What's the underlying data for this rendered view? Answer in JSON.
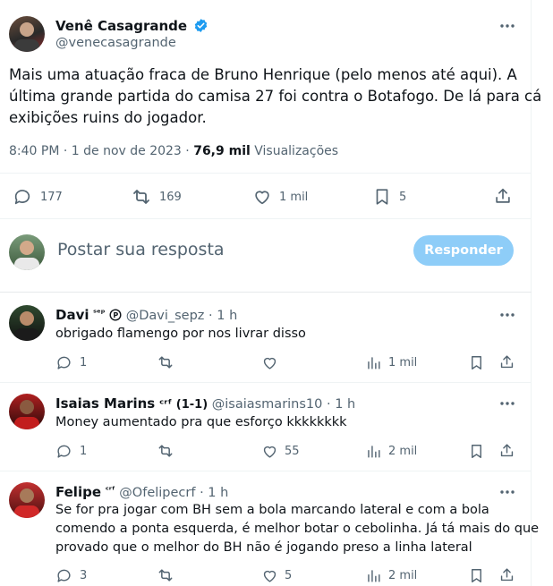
{
  "main_post": {
    "author_name": "Venê Casagrande",
    "author_handle": "@venecasagrande",
    "text_lines": [
      "Mais uma atuação fraca de Bruno Henrique (pelo menos até aqui). A",
      "última grande partida do camisa 27 foi contra o Botafogo. De lá para cá",
      "exibições ruins do jogador."
    ],
    "time": "8:40 PM",
    "date": "1 de nov de 2023",
    "views_count": "76,9 mil",
    "views_label": "Visualizações",
    "replies": "177",
    "reposts": "169",
    "likes": "1 mil",
    "bookmarks": "5"
  },
  "composer": {
    "placeholder": "Postar sua resposta",
    "button_label": "Responder"
  },
  "replies": [
    {
      "name": "Davi",
      "name_suffix": "ˢᵉᵖ",
      "handle": "@Davi_sepz",
      "time": "1 h",
      "lines": [
        "obrigado flamengo por nos livrar disso"
      ],
      "replies": "1",
      "reposts": "",
      "likes": "",
      "views": "1 mil"
    },
    {
      "name": "Isaias Marins",
      "name_suffix": "ᶜʳᶠ (1-1)",
      "handle": "@isaiasmarins10",
      "time": "1 h",
      "lines": [
        "Money aumentado pra que esforço kkkkkkkk"
      ],
      "replies": "1",
      "reposts": "",
      "likes": "55",
      "views": "2 mil"
    },
    {
      "name": "Felipe",
      "name_suffix": "ᶜʳᶠ",
      "handle": "@Ofelipecrf",
      "time": "1 h",
      "lines": [
        "Se for pra jogar com BH sem a bola marcando lateral e com a bola",
        "comendo a ponta esquerda, é melhor botar o cebolinha. Já tá mais do que",
        "provado que o melhor do BH não é jogando preso a linha lateral"
      ],
      "replies": "3",
      "reposts": "",
      "likes": "5",
      "views": "2 mil"
    }
  ],
  "colors": {
    "verified_blue": "#1d9bf0",
    "button_disabled_bg": "#8ecdf8",
    "muted_text": "#536471",
    "divider": "#eff3f4"
  }
}
